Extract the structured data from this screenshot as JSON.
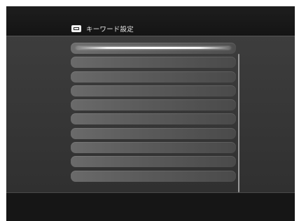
{
  "header": {
    "title": "キーワード設定",
    "icon": "keyboard-icon"
  },
  "keyword_list": {
    "items": [
      {
        "label": "",
        "selected": true
      },
      {
        "label": "",
        "selected": false
      },
      {
        "label": "",
        "selected": false
      },
      {
        "label": "",
        "selected": false
      },
      {
        "label": "",
        "selected": false
      },
      {
        "label": "",
        "selected": false
      },
      {
        "label": "",
        "selected": false
      },
      {
        "label": "",
        "selected": false
      },
      {
        "label": "",
        "selected": false
      },
      {
        "label": "",
        "selected": false
      }
    ]
  },
  "colors": {
    "background": "#2a2a2a",
    "header": "#141414",
    "row": "#5a5a5a",
    "highlight": "#ffffff"
  }
}
